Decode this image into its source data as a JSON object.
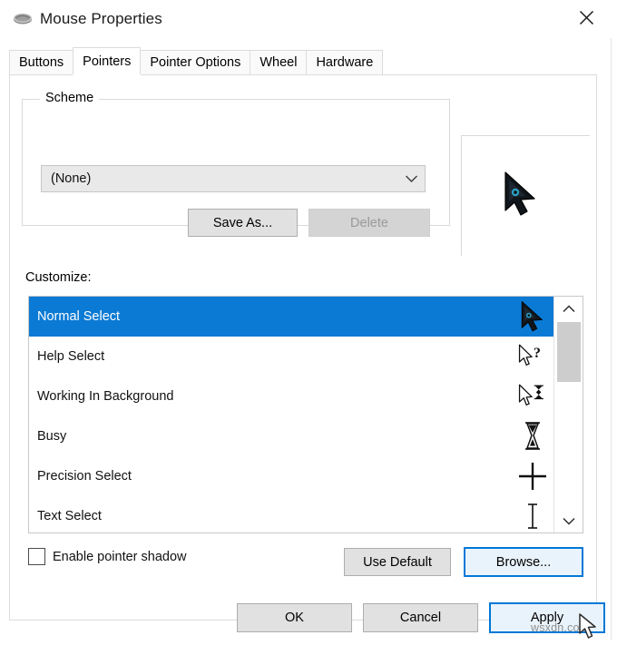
{
  "window": {
    "title": "Mouse Properties",
    "icon": "mouse-icon",
    "close_icon": "close-icon"
  },
  "tabs": [
    {
      "label": "Buttons",
      "active": false
    },
    {
      "label": "Pointers",
      "active": true
    },
    {
      "label": "Pointer Options",
      "active": false
    },
    {
      "label": "Wheel",
      "active": false
    },
    {
      "label": "Hardware",
      "active": false
    }
  ],
  "scheme": {
    "legend": "Scheme",
    "combo_value": "(None)",
    "combo_arrow_icon": "chevron-down-icon",
    "save_as_label": "Save As...",
    "delete_label": "Delete",
    "delete_disabled": true
  },
  "preview": {
    "cursor_icon": "normal-select-cursor-icon"
  },
  "customize": {
    "label": "Customize:",
    "items": [
      {
        "label": "Normal Select",
        "icon": "normal-select-cursor-icon",
        "selected": true
      },
      {
        "label": "Help Select",
        "icon": "help-select-cursor-icon",
        "selected": false
      },
      {
        "label": "Working In Background",
        "icon": "working-in-background-cursor-icon",
        "selected": false
      },
      {
        "label": "Busy",
        "icon": "busy-hourglass-cursor-icon",
        "selected": false
      },
      {
        "label": "Precision Select",
        "icon": "precision-crosshair-cursor-icon",
        "selected": false
      },
      {
        "label": "Text Select",
        "icon": "text-ibeam-cursor-icon",
        "selected": false
      }
    ],
    "scrollbar": {
      "up_icon": "chevron-up-icon",
      "down_icon": "chevron-down-icon"
    }
  },
  "options": {
    "pointer_shadow_label": "Enable pointer shadow",
    "pointer_shadow_checked": false,
    "use_default_label": "Use Default",
    "browse_label": "Browse..."
  },
  "footer": {
    "ok_label": "OK",
    "cancel_label": "Cancel",
    "apply_label": "Apply"
  },
  "overlay": {
    "watermark": "wsxdn.com",
    "cursor_icon": "mouse-pointer-icon"
  },
  "colors": {
    "selection_blue": "#0b7ad4",
    "focus_blue": "#0078d7",
    "button_face": "#e1e1e1",
    "window_bg": "#ffffff",
    "cursor_accent": "#2b9fc4"
  }
}
